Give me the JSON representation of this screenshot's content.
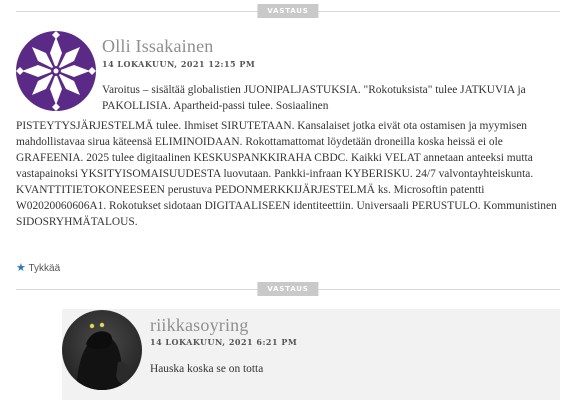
{
  "reply_label": "VASTAUS",
  "comment1": {
    "author": "Olli Issakainen",
    "date": "14 LOKAKUUN, 2021 12:15 PM",
    "text_first": "Varoitus – sisältää globalistien JUONIPALJASTUKSIA. \"Rokotuksista\" tulee JATKUVIA ja PAKOLLISIA. Apartheid-passi tulee. Sosiaalinen",
    "text_rest": "PISTEYTYSJÄRJESTELMÄ tulee. Ihmiset SIRUTETAAN. Kansalaiset jotka eivät ota ostamisen ja myymisen mahdollistavaa sirua käteensä ELIMINOIDAAN. Rokottamattomat löydetään droneilla koska heissä ei ole GRAFEENIA. 2025 tulee digitaalinen KESKUSPANKKIRAHA CBDC. Kaikki VELAT annetaan anteeksi mutta vastapainoksi YKSITYISOMAISUUDESTA luovutaan. Pankki-infraan KYBERISKU. 24/7 valvontayhteiskunta. KVANTTITIETOKONEESEEN perustuva PEDONMERKKIJÄRJESTELMÄ ks. Microsoftin patentti W02020060606A1. Rokotukset sidotaan DIGITAALISEEN identiteettiin. Universaali PERUSTULO. Kommunistinen SIDOSRYHMÄTALOUS.",
    "like_label": "Tykkää"
  },
  "comment2": {
    "author": "riikkasoyring",
    "date": "14 LOKAKUUN, 2021 6:21 PM",
    "text": "Hauska koska se on totta"
  },
  "colors": {
    "avatar_purple": "#5b2a86",
    "like_star": "#2a7ab7",
    "reply_bg": "#c9c9c9"
  }
}
